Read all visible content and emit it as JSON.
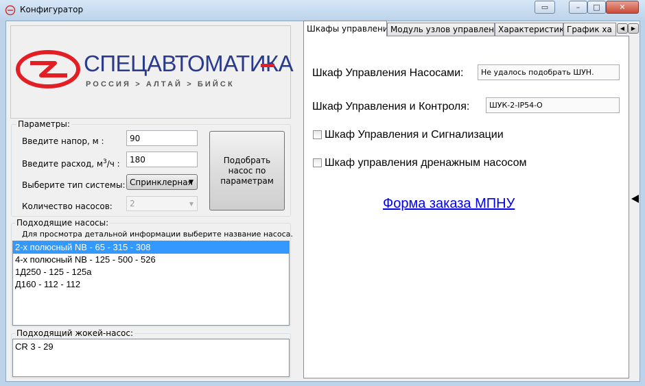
{
  "window": {
    "title": "Конфигуратор"
  },
  "logo": {
    "brand": "СПЕЦАВТОМАТИКА",
    "tagline": "РОССИЯ > АЛТАЙ > БИЙСК",
    "accent": "#e31e24",
    "blue": "#2a3a8c"
  },
  "params": {
    "legend": "Параметры:",
    "head_label": "Введите напор, м :",
    "head_value": "90",
    "flow_label_a": "Введите расход, м",
    "flow_label_sup": "3",
    "flow_label_b": "/ч :",
    "flow_value": "180",
    "system_label": "Выберите тип системы:",
    "system_value": "Спринклерная",
    "count_label": "Количество насосов:",
    "count_value": "2",
    "select_button": "Подобрать насос по параметрам"
  },
  "pumps": {
    "legend": "Подходящие насосы:",
    "hint": "Для просмотра детальной информации выберите название насоса.",
    "items": [
      "2-х полюсный NB - 65 - 315 - 308",
      "4-х полюсный NB - 125 - 500 - 526",
      "1Д250 - 125 - 125а",
      "Д160 - 112 - 112"
    ]
  },
  "jockey": {
    "legend": "Подходящий жокей-насос:",
    "value": "CR 3 - 29"
  },
  "tabs": [
    "Шкафы управления",
    "Модуль узлов управления",
    "Характеристики",
    "График ха"
  ],
  "cabinets": {
    "pump_label": "Шкаф Управления Насосами:",
    "pump_value": "Не удалось подобрать ШУН.",
    "control_label": "Шкаф Управления и Контроля:",
    "control_value": "ШУК-2-IP54-О",
    "signal_label": "Шкаф Управления и Сигнализации",
    "drain_label": "Шкаф управления дренажным насосом",
    "order_link": "Форма заказа МПНУ"
  }
}
